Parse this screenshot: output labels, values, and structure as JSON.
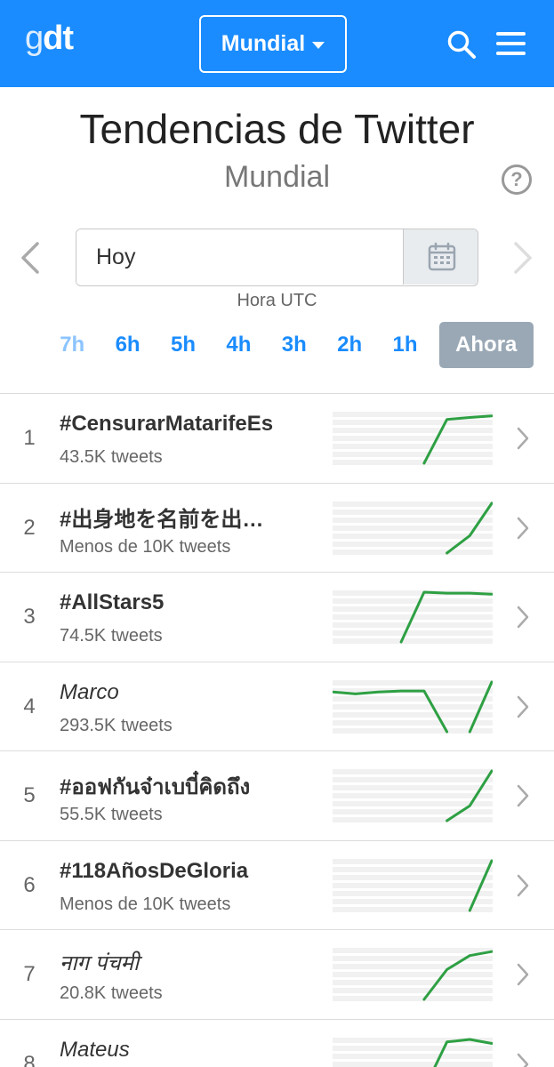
{
  "header": {
    "logo_g": "g",
    "logo_dt": "dt",
    "region_label": "Mundial",
    "icons": {
      "search": "search-icon",
      "menu": "hamburger-menu-icon",
      "caret": "caret-down-icon"
    }
  },
  "page": {
    "title": "Tendencias de Twitter",
    "subtitle": "Mundial",
    "help_symbol": "?"
  },
  "date": {
    "value": "Hoy",
    "timezone_label": "Hora UTC"
  },
  "hours": [
    {
      "label": "7h",
      "state": "faded"
    },
    {
      "label": "6h",
      "state": "normal"
    },
    {
      "label": "5h",
      "state": "normal"
    },
    {
      "label": "4h",
      "state": "normal"
    },
    {
      "label": "3h",
      "state": "normal"
    },
    {
      "label": "2h",
      "state": "normal"
    },
    {
      "label": "1h",
      "state": "normal"
    },
    {
      "label": "Ahora",
      "state": "active"
    }
  ],
  "colors": {
    "brand": "#1a8cff",
    "spark_line": "#2ea043",
    "active_tab": "#9aa8b6"
  },
  "trends": [
    {
      "rank": "1",
      "name": "#CensurarMatarifeEs",
      "count": "43.5K tweets",
      "hashtag": true,
      "spark": [
        [
          4,
          0.0
        ],
        [
          5,
          0.88
        ],
        [
          6,
          0.92
        ],
        [
          7,
          0.95
        ]
      ]
    },
    {
      "rank": "2",
      "name": "#出身地を名前を出…",
      "count": "Menos de 10K tweets",
      "hashtag": true,
      "spark": [
        [
          5,
          0.0
        ],
        [
          6,
          0.35
        ],
        [
          7,
          1.0
        ],
        [
          7.5,
          1.0
        ]
      ]
    },
    {
      "rank": "3",
      "name": "#AllStars5",
      "count": "74.5K tweets",
      "hashtag": true,
      "spark": [
        [
          3,
          0.0
        ],
        [
          4,
          1.0
        ],
        [
          5,
          0.98
        ],
        [
          6,
          0.98
        ],
        [
          7,
          0.96
        ]
      ]
    },
    {
      "rank": "4",
      "name": "Marco",
      "count": "293.5K tweets",
      "hashtag": false,
      "spark": [
        [
          0,
          0.8
        ],
        [
          1,
          0.76
        ],
        [
          2,
          0.8
        ],
        [
          3,
          0.82
        ],
        [
          4,
          0.82
        ],
        [
          5,
          0.0
        ],
        null,
        [
          6,
          0.0
        ],
        [
          7,
          1.0
        ]
      ]
    },
    {
      "rank": "5",
      "name": "#ออฟกันจ๋าเบบี๋คิดถึง",
      "count": "55.5K tweets",
      "hashtag": true,
      "spark": [
        [
          5,
          0.0
        ],
        [
          6,
          0.3
        ],
        [
          7,
          1.0
        ]
      ]
    },
    {
      "rank": "6",
      "name": "#118AñosDeGloria",
      "count": "Menos de 10K tweets",
      "hashtag": true,
      "spark": [
        [
          6,
          0.0
        ],
        [
          7,
          1.0
        ]
      ]
    },
    {
      "rank": "7",
      "name": "नाग पंचमी",
      "count": "20.8K tweets",
      "hashtag": false,
      "spark": [
        [
          4,
          0.0
        ],
        [
          5,
          0.6
        ],
        [
          6,
          0.88
        ],
        [
          7,
          0.96
        ]
      ]
    },
    {
      "rank": "8",
      "name": "Mateus",
      "count": "",
      "hashtag": false,
      "spark": [
        [
          4,
          0.0
        ],
        [
          5,
          0.95
        ],
        [
          6,
          1.0
        ],
        [
          7,
          0.92
        ]
      ]
    }
  ]
}
